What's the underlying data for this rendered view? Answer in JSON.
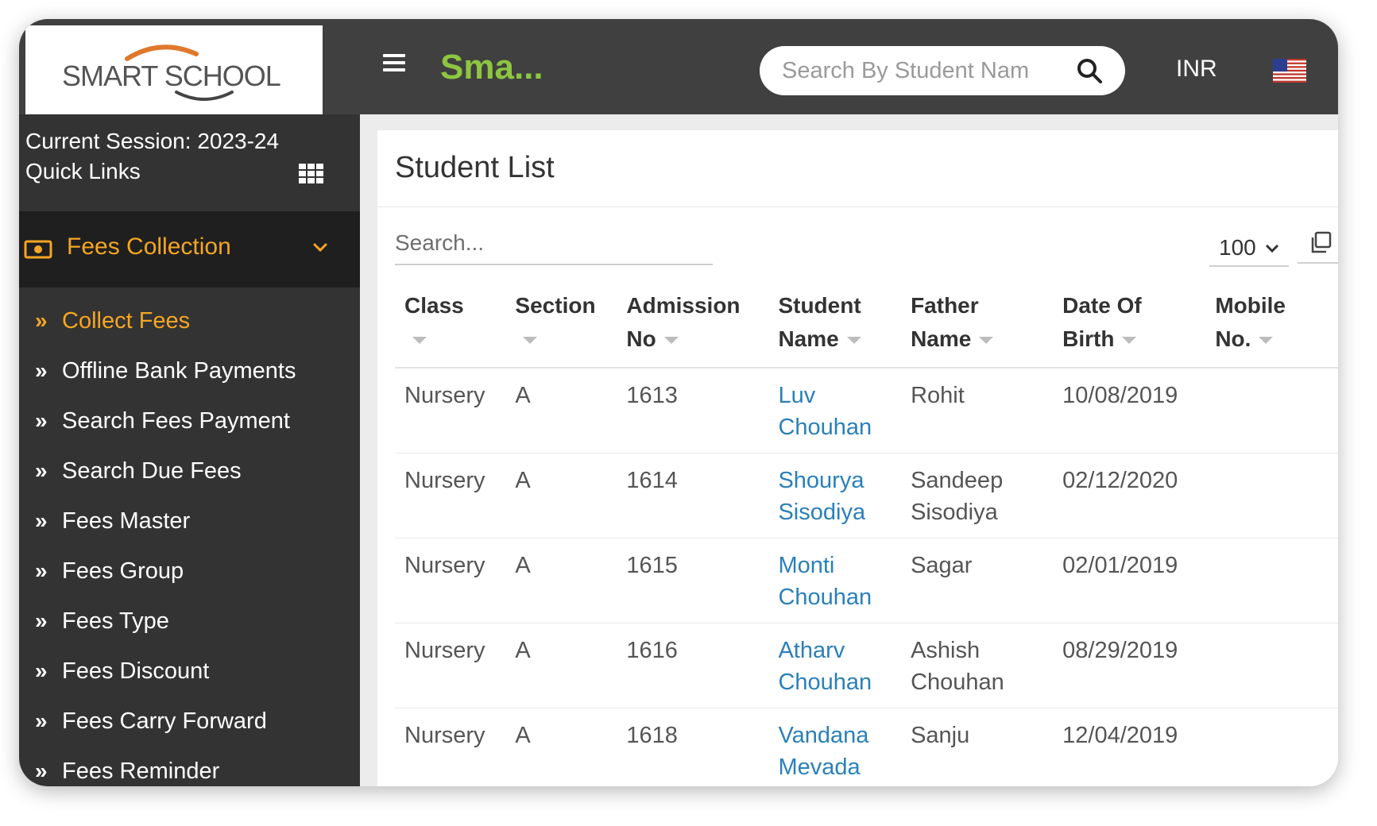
{
  "header": {
    "logo_text": "SMART SCHOOL",
    "brand_title": "Sma...",
    "search_placeholder": "Search By Student Nam",
    "currency": "INR",
    "flag": "us-flag-icon"
  },
  "sidebar": {
    "session": "Current Session: 2023-24",
    "quick_links": "Quick Links",
    "section_label": "Fees Collection",
    "items": [
      {
        "label": "Collect Fees",
        "active": true
      },
      {
        "label": "Offline Bank Payments"
      },
      {
        "label": "Search Fees Payment"
      },
      {
        "label": "Search Due Fees"
      },
      {
        "label": "Fees Master"
      },
      {
        "label": "Fees Group"
      },
      {
        "label": "Fees Type"
      },
      {
        "label": "Fees Discount"
      },
      {
        "label": "Fees Carry Forward"
      },
      {
        "label": "Fees Reminder"
      }
    ]
  },
  "main": {
    "title": "Student List",
    "search_placeholder": "Search...",
    "page_size": "100",
    "columns": [
      {
        "line1": "Class",
        "line2": ""
      },
      {
        "line1": "Section",
        "line2": ""
      },
      {
        "line1": "Admission",
        "line2": "No"
      },
      {
        "line1": "Student",
        "line2": "Name"
      },
      {
        "line1": "Father",
        "line2": "Name"
      },
      {
        "line1": "Date Of",
        "line2": "Birth"
      },
      {
        "line1": "Mobile",
        "line2": "No."
      }
    ],
    "rows": [
      {
        "class": "Nursery",
        "section": "A",
        "admission_no": "1613",
        "student_first": "Luv",
        "student_last": "Chouhan",
        "father_first": "Rohit",
        "father_last": "",
        "dob": "10/08/2019",
        "mobile": ""
      },
      {
        "class": "Nursery",
        "section": "A",
        "admission_no": "1614",
        "student_first": "Shourya",
        "student_last": "Sisodiya",
        "father_first": "Sandeep",
        "father_last": "Sisodiya",
        "dob": "02/12/2020",
        "mobile": ""
      },
      {
        "class": "Nursery",
        "section": "A",
        "admission_no": "1615",
        "student_first": "Monti",
        "student_last": "Chouhan",
        "father_first": "Sagar",
        "father_last": "",
        "dob": "02/01/2019",
        "mobile": ""
      },
      {
        "class": "Nursery",
        "section": "A",
        "admission_no": "1616",
        "student_first": "Atharv",
        "student_last": "Chouhan",
        "father_first": "Ashish",
        "father_last": "Chouhan",
        "dob": "08/29/2019",
        "mobile": ""
      },
      {
        "class": "Nursery",
        "section": "A",
        "admission_no": "1618",
        "student_first": "Vandana",
        "student_last": "Mevada",
        "father_first": "Sanju",
        "father_last": "",
        "dob": "12/04/2019",
        "mobile": ""
      }
    ]
  },
  "colors": {
    "topbar": "#404040",
    "sidebar": "#333333",
    "accent_orange": "#f5a623",
    "brand_green": "#8dc63f",
    "link_blue": "#2a80b9"
  }
}
